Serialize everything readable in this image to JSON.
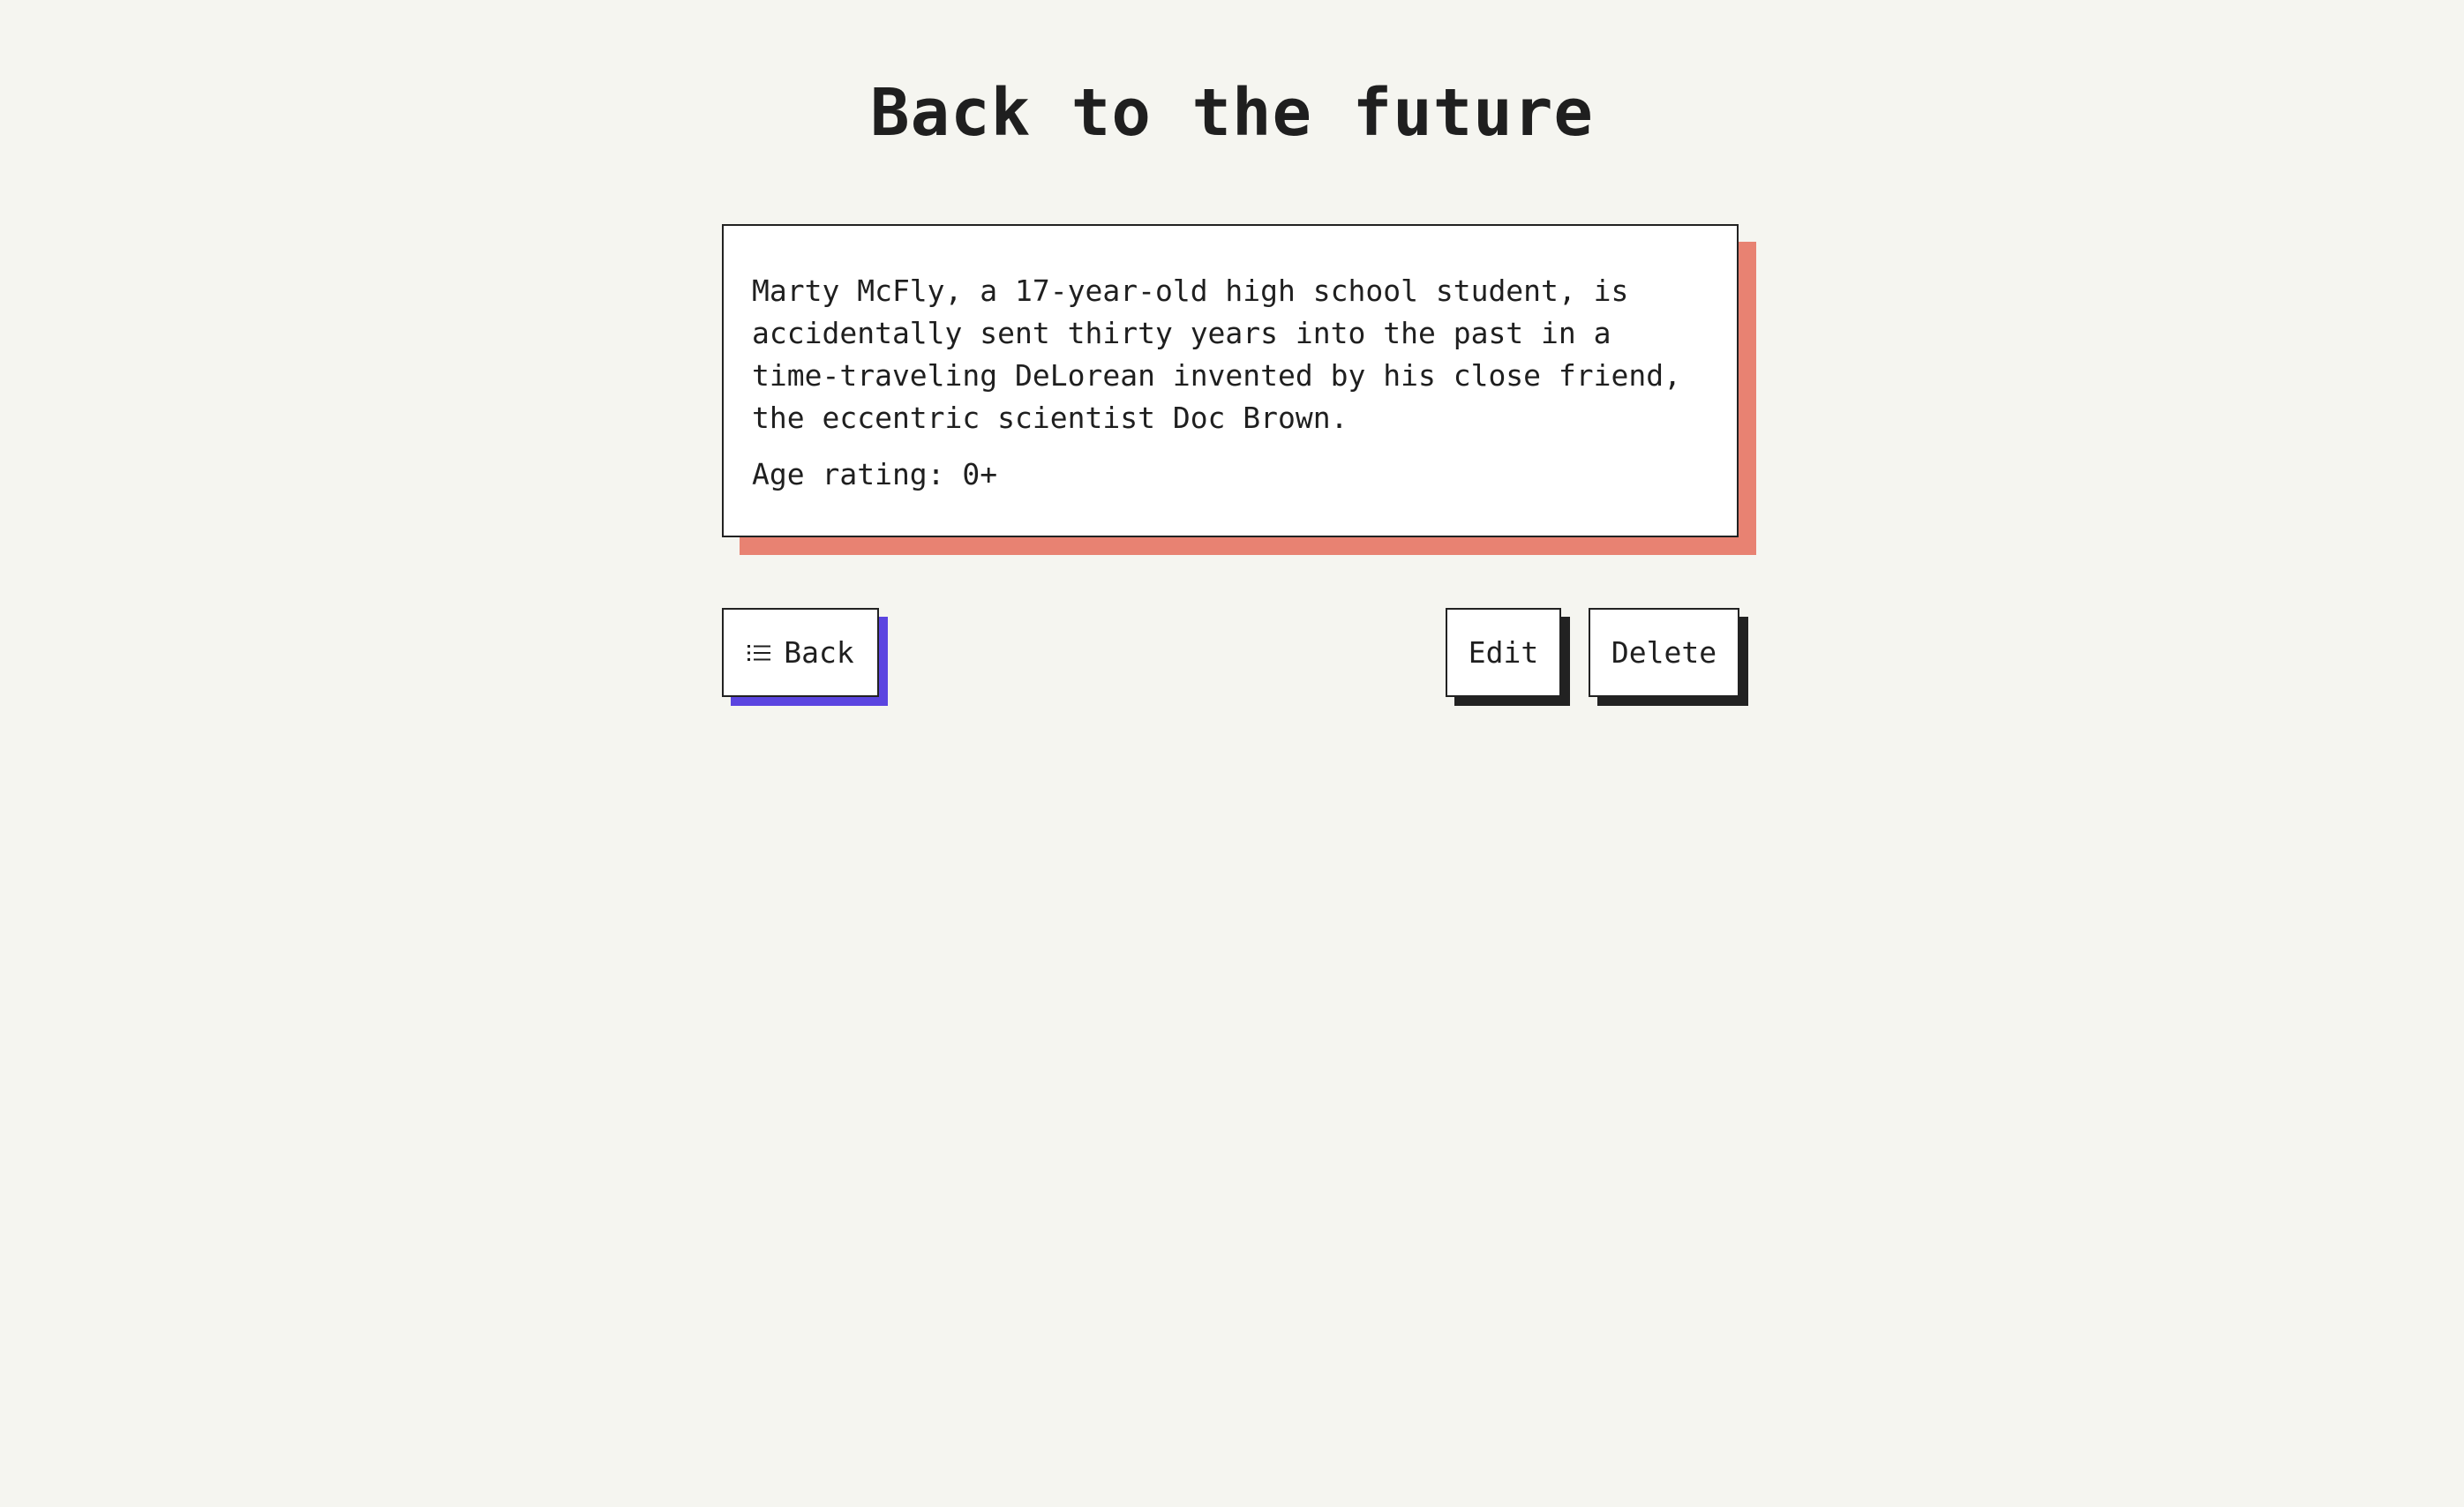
{
  "page": {
    "title": "Back to the future"
  },
  "card": {
    "description": "Marty McFly, a 17-year-old high school student, is accidentally sent thirty years into the past in a time-traveling DeLorean invented by his close friend, the eccentric scientist Doc Brown.",
    "age_rating": "Age rating: 0+"
  },
  "actions": {
    "back_label": "Back",
    "back_icon": "list-icon",
    "edit_label": "Edit",
    "delete_label": "Delete"
  },
  "colors": {
    "background": "#f5f5f0",
    "card_shadow": "#e88272",
    "back_shadow": "#5b45e0",
    "button_shadow": "#222222"
  }
}
